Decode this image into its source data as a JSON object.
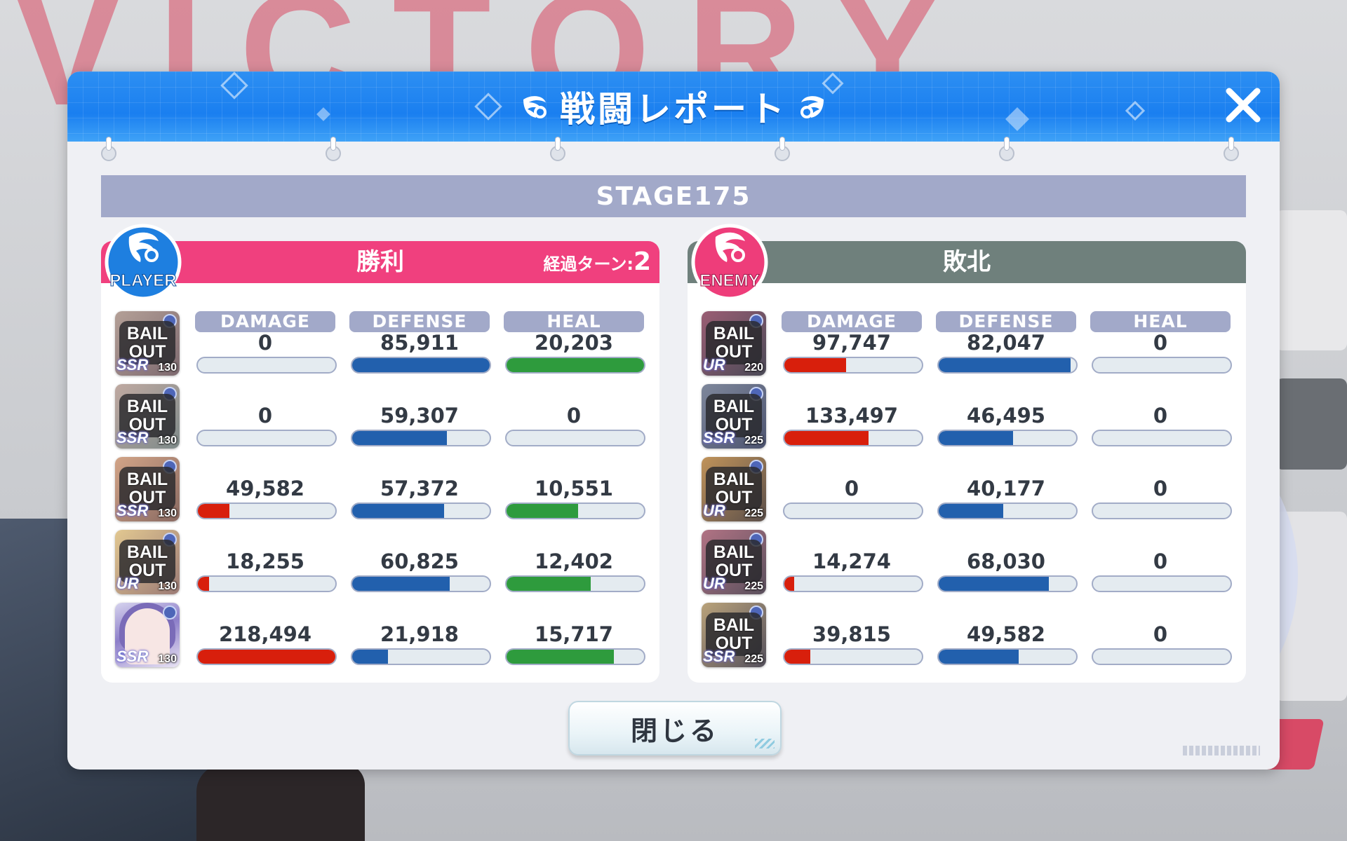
{
  "background": {
    "big_word": "VICTORY"
  },
  "dialog": {
    "title": "戦闘レポート",
    "stage": "STAGE175",
    "close_button_label": "閉じる"
  },
  "stat_labels": {
    "damage": "DAMAGE",
    "defense": "DEFENSE",
    "heal": "HEAL"
  },
  "colors": {
    "player_header": "#f0407e",
    "enemy_header": "#6f807c",
    "damage_bar": "#d81f0c",
    "defense_bar": "#2260ad",
    "heal_bar": "#2e9b3d",
    "title_bar": "#1a7ff0"
  },
  "player": {
    "badge": "PLAYER",
    "result": "勝利",
    "turns_label": "経過ターン:",
    "turns_value": "2",
    "rows": [
      {
        "status": "BAIL OUT",
        "rank": "SSR",
        "level": "130",
        "damage": "0",
        "defense": "85,911",
        "heal": "20,203",
        "damage_fill": 0.0,
        "defense_fill": 1.0,
        "heal_fill": 1.0
      },
      {
        "status": "BAIL OUT",
        "rank": "SSR",
        "level": "130",
        "damage": "0",
        "defense": "59,307",
        "heal": "0",
        "damage_fill": 0.0,
        "defense_fill": 0.69,
        "heal_fill": 0.0
      },
      {
        "status": "BAIL OUT",
        "rank": "SSR",
        "level": "130",
        "damage": "49,582",
        "defense": "57,372",
        "heal": "10,551",
        "damage_fill": 0.23,
        "defense_fill": 0.67,
        "heal_fill": 0.52
      },
      {
        "status": "BAIL OUT",
        "rank": "UR",
        "level": "130",
        "damage": "18,255",
        "defense": "60,825",
        "heal": "12,402",
        "damage_fill": 0.08,
        "defense_fill": 0.71,
        "heal_fill": 0.61
      },
      {
        "status": "",
        "rank": "SSR",
        "level": "130",
        "damage": "218,494",
        "defense": "21,918",
        "heal": "15,717",
        "damage_fill": 1.0,
        "defense_fill": 0.26,
        "heal_fill": 0.78
      }
    ]
  },
  "enemy": {
    "badge": "ENEMY",
    "result": "敗北",
    "rows": [
      {
        "status": "BAIL OUT",
        "rank": "UR",
        "level": "220",
        "damage": "97,747",
        "defense": "82,047",
        "heal": "0",
        "damage_fill": 0.45,
        "defense_fill": 0.96,
        "heal_fill": 0.0
      },
      {
        "status": "BAIL OUT",
        "rank": "SSR",
        "level": "225",
        "damage": "133,497",
        "defense": "46,495",
        "heal": "0",
        "damage_fill": 0.61,
        "defense_fill": 0.54,
        "heal_fill": 0.0
      },
      {
        "status": "BAIL OUT",
        "rank": "UR",
        "level": "225",
        "damage": "0",
        "defense": "40,177",
        "heal": "0",
        "damage_fill": 0.0,
        "defense_fill": 0.47,
        "heal_fill": 0.0
      },
      {
        "status": "BAIL OUT",
        "rank": "UR",
        "level": "225",
        "damage": "14,274",
        "defense": "68,030",
        "heal": "0",
        "damage_fill": 0.07,
        "defense_fill": 0.8,
        "heal_fill": 0.0
      },
      {
        "status": "BAIL OUT",
        "rank": "SSR",
        "level": "225",
        "damage": "39,815",
        "defense": "49,582",
        "heal": "0",
        "damage_fill": 0.19,
        "defense_fill": 0.58,
        "heal_fill": 0.0
      }
    ]
  }
}
